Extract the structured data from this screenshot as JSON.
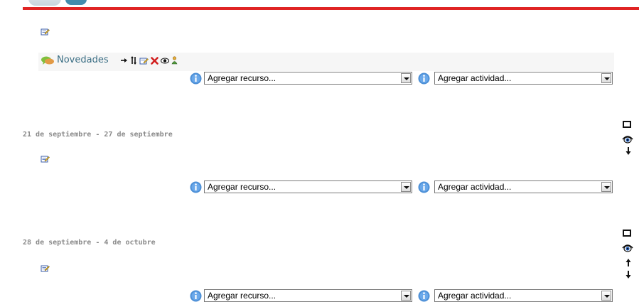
{
  "page": {
    "title": ""
  },
  "icons": {
    "edit": "edit-summary-icon",
    "news": "forum-icon",
    "info": "info-icon",
    "eye": "eye-icon",
    "highlight": "highlight-icon",
    "move_down": "arrow-down-icon",
    "move_up": "arrow-up-icon"
  },
  "news_section": {
    "link_label": "Novedades",
    "tools": [
      "move-right-icon",
      "move-updown-icon",
      "edit-icon",
      "delete-icon",
      "hide-icon",
      "roles-icon"
    ]
  },
  "controls": {
    "add_resource_placeholder": "Agregar recurso...",
    "add_activity_placeholder": "Agregar actividad..."
  },
  "weeks": [
    {
      "label": "21 de septiembre - 27 de septiembre"
    },
    {
      "label": "28 de septiembre - 4 de octubre"
    }
  ],
  "colors": {
    "accent_red": "#e02424",
    "link": "#3c6f85",
    "date_label": "#8a8a8a"
  }
}
